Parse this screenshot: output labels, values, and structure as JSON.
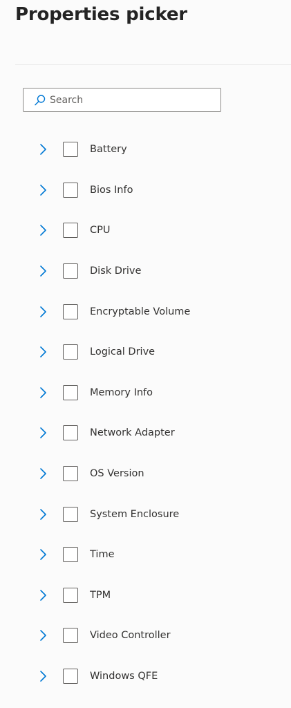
{
  "header": {
    "title": "Properties picker"
  },
  "search": {
    "placeholder": "Search",
    "value": "",
    "icon": "search-icon"
  },
  "colors": {
    "accent": "#0078d4",
    "text": "#323130",
    "background": "#fbfbfb"
  },
  "properties": [
    {
      "label": "Battery",
      "checked": false,
      "expanded": false
    },
    {
      "label": "Bios Info",
      "checked": false,
      "expanded": false
    },
    {
      "label": "CPU",
      "checked": false,
      "expanded": false
    },
    {
      "label": "Disk Drive",
      "checked": false,
      "expanded": false
    },
    {
      "label": "Encryptable Volume",
      "checked": false,
      "expanded": false
    },
    {
      "label": "Logical Drive",
      "checked": false,
      "expanded": false
    },
    {
      "label": "Memory Info",
      "checked": false,
      "expanded": false
    },
    {
      "label": "Network Adapter",
      "checked": false,
      "expanded": false
    },
    {
      "label": "OS Version",
      "checked": false,
      "expanded": false
    },
    {
      "label": "System Enclosure",
      "checked": false,
      "expanded": false
    },
    {
      "label": "Time",
      "checked": false,
      "expanded": false
    },
    {
      "label": "TPM",
      "checked": false,
      "expanded": false
    },
    {
      "label": "Video Controller",
      "checked": false,
      "expanded": false
    },
    {
      "label": "Windows QFE",
      "checked": false,
      "expanded": false
    }
  ]
}
